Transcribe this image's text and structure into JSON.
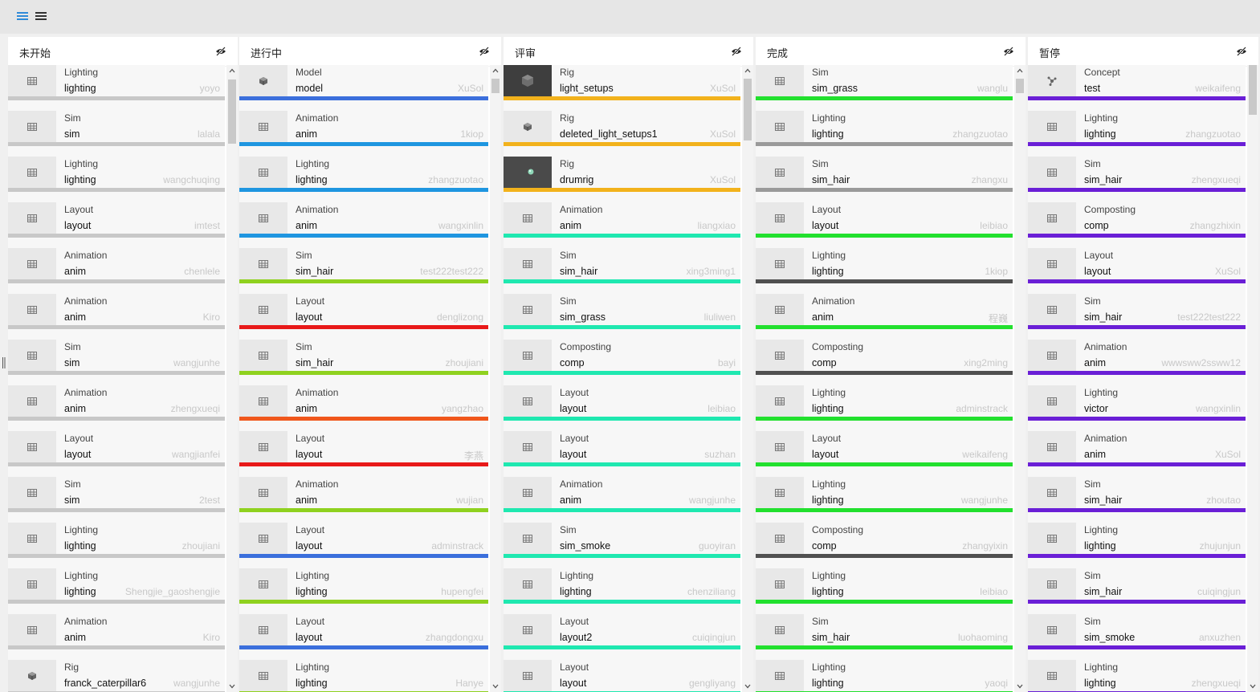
{
  "toolbar": {
    "buttons": [
      {
        "name": "list-view-icon",
        "color": "#2f8ad8"
      },
      {
        "name": "menu-icon",
        "color": "#333333"
      }
    ]
  },
  "columns": [
    {
      "title": "未开始",
      "hide_icon": "eye-slash-icon",
      "bar_color": "#c8c8c8",
      "cards": [
        {
          "step": "Lighting",
          "task": "lighting",
          "assignee": "yoyo",
          "icon": "table-icon"
        },
        {
          "step": "Sim",
          "task": "sim",
          "assignee": "lalala",
          "icon": "table-icon"
        },
        {
          "step": "Lighting",
          "task": "lighting",
          "assignee": "wangchuqing",
          "icon": "table-icon"
        },
        {
          "step": "Layout",
          "task": "layout",
          "assignee": "imtest",
          "icon": "table-icon"
        },
        {
          "step": "Animation",
          "task": "anim",
          "assignee": "chenlele",
          "icon": "table-icon"
        },
        {
          "step": "Animation",
          "task": "anim",
          "assignee": "Kiro",
          "icon": "table-icon"
        },
        {
          "step": "Sim",
          "task": "sim",
          "assignee": "wangjunhe",
          "icon": "table-icon"
        },
        {
          "step": "Animation",
          "task": "anim",
          "assignee": "zhengxueqi",
          "icon": "table-icon"
        },
        {
          "step": "Layout",
          "task": "layout",
          "assignee": "wangjianfei",
          "icon": "table-icon"
        },
        {
          "step": "Sim",
          "task": "sim",
          "assignee": "2test",
          "icon": "table-icon"
        },
        {
          "step": "Lighting",
          "task": "lighting",
          "assignee": "zhoujiani",
          "icon": "table-icon"
        },
        {
          "step": "Lighting",
          "task": "lighting",
          "assignee": "Shengjie_gaoshengjie",
          "icon": "table-icon"
        },
        {
          "step": "Animation",
          "task": "anim",
          "assignee": "Kiro",
          "icon": "table-icon"
        },
        {
          "step": "Rig",
          "task": "franck_caterpillar6",
          "assignee": "wangjunhe",
          "icon": "cube-icon"
        }
      ]
    },
    {
      "title": "进行中",
      "hide_icon": "eye-slash-icon",
      "cards": [
        {
          "step": "Model",
          "task": "model",
          "assignee": "XuSol",
          "icon": "cube-icon",
          "color": "#3b6fdc"
        },
        {
          "step": "Animation",
          "task": "anim",
          "assignee": "1kiop",
          "icon": "table-icon",
          "color": "#1f96e0"
        },
        {
          "step": "Lighting",
          "task": "lighting",
          "assignee": "zhangzuotao",
          "icon": "table-icon",
          "color": "#1f96e0"
        },
        {
          "step": "Animation",
          "task": "anim",
          "assignee": "wangxinlin",
          "icon": "table-icon",
          "color": "#1f96e0"
        },
        {
          "step": "Sim",
          "task": "sim_hair",
          "assignee": "test222test222",
          "icon": "table-icon",
          "color": "#8fd11f"
        },
        {
          "step": "Layout",
          "task": "layout",
          "assignee": "denglizong",
          "icon": "table-icon",
          "color": "#e81919"
        },
        {
          "step": "Sim",
          "task": "sim_hair",
          "assignee": "zhoujiani",
          "icon": "table-icon",
          "color": "#8fd11f"
        },
        {
          "step": "Animation",
          "task": "anim",
          "assignee": "yangzhao",
          "icon": "table-icon",
          "color": "#f0571c"
        },
        {
          "step": "Layout",
          "task": "layout",
          "assignee": "李燕",
          "icon": "table-icon",
          "color": "#e81919"
        },
        {
          "step": "Animation",
          "task": "anim",
          "assignee": "wujian",
          "icon": "table-icon",
          "color": "#8fd11f"
        },
        {
          "step": "Layout",
          "task": "layout",
          "assignee": "adminstrack",
          "icon": "table-icon",
          "color": "#3b6fdc"
        },
        {
          "step": "Lighting",
          "task": "lighting",
          "assignee": "hupengfei",
          "icon": "table-icon",
          "color": "#8fd11f"
        },
        {
          "step": "Layout",
          "task": "layout",
          "assignee": "zhangdongxu",
          "icon": "table-icon",
          "color": "#3b6fdc"
        },
        {
          "step": "Lighting",
          "task": "lighting",
          "assignee": "Hanye",
          "icon": "table-icon",
          "color": "#8fd11f"
        }
      ]
    },
    {
      "title": "评审",
      "hide_icon": "eye-slash-icon",
      "cards": [
        {
          "step": "Rig",
          "task": "light_setups",
          "assignee": "XuSol",
          "icon": "render-thumbnail",
          "color": "#f2b21c"
        },
        {
          "step": "Rig",
          "task": "deleted_light_setups1",
          "assignee": "XuSol",
          "icon": "cube-icon",
          "color": "#f2b21c"
        },
        {
          "step": "Rig",
          "task": "drumrig",
          "assignee": "XuSol",
          "icon": "sphere-thumbnail",
          "color": "#f2b21c"
        },
        {
          "step": "Animation",
          "task": "anim",
          "assignee": "liangxiao",
          "icon": "table-icon",
          "color": "#1fe8b0"
        },
        {
          "step": "Sim",
          "task": "sim_hair",
          "assignee": "xing3ming1",
          "icon": "table-icon",
          "color": "#1fe8b0"
        },
        {
          "step": "Sim",
          "task": "sim_grass",
          "assignee": "liuliwen",
          "icon": "table-icon",
          "color": "#1fe8b0"
        },
        {
          "step": "Composting",
          "task": "comp",
          "assignee": "bayi",
          "icon": "table-icon",
          "color": "#1fe8b0"
        },
        {
          "step": "Layout",
          "task": "layout",
          "assignee": "leibiao",
          "icon": "table-icon",
          "color": "#1fe8b0"
        },
        {
          "step": "Layout",
          "task": "layout",
          "assignee": "suzhan",
          "icon": "table-icon",
          "color": "#1fe8b0"
        },
        {
          "step": "Animation",
          "task": "anim",
          "assignee": "wangjunhe",
          "icon": "table-icon",
          "color": "#1fe8b0"
        },
        {
          "step": "Sim",
          "task": "sim_smoke",
          "assignee": "guoyiran",
          "icon": "table-icon",
          "color": "#1fe8b0"
        },
        {
          "step": "Lighting",
          "task": "lighting",
          "assignee": "chenziliang",
          "icon": "table-icon",
          "color": "#1fe8b0"
        },
        {
          "step": "Layout",
          "task": "layout2",
          "assignee": "cuiqingjun",
          "icon": "table-icon",
          "color": "#1fe8b0"
        },
        {
          "step": "Layout",
          "task": "layout",
          "assignee": "gengliyang",
          "icon": "table-icon",
          "color": "#1fe8b0"
        }
      ]
    },
    {
      "title": "完成",
      "hide_icon": "eye-slash-icon",
      "cards": [
        {
          "step": "Sim",
          "task": "sim_grass",
          "assignee": "wanglu",
          "icon": "table-icon",
          "color": "#22e02e"
        },
        {
          "step": "Lighting",
          "task": "lighting",
          "assignee": "zhangzuotao",
          "icon": "table-icon",
          "color": "#9a9a9a"
        },
        {
          "step": "Sim",
          "task": "sim_hair",
          "assignee": "zhangxu",
          "icon": "table-icon",
          "color": "#9a9a9a"
        },
        {
          "step": "Layout",
          "task": "layout",
          "assignee": "leibiao",
          "icon": "table-icon",
          "color": "#22e02e"
        },
        {
          "step": "Lighting",
          "task": "lighting",
          "assignee": "1kiop",
          "icon": "table-icon",
          "color": "#505050"
        },
        {
          "step": "Animation",
          "task": "anim",
          "assignee": "程巍",
          "icon": "table-icon",
          "color": "#22e02e"
        },
        {
          "step": "Composting",
          "task": "comp",
          "assignee": "xing2ming",
          "icon": "table-icon",
          "color": "#505050"
        },
        {
          "step": "Lighting",
          "task": "lighting",
          "assignee": "adminstrack",
          "icon": "table-icon",
          "color": "#22e02e"
        },
        {
          "step": "Layout",
          "task": "layout",
          "assignee": "weikaifeng",
          "icon": "table-icon",
          "color": "#22e02e"
        },
        {
          "step": "Lighting",
          "task": "lighting",
          "assignee": "wangjunhe",
          "icon": "table-icon",
          "color": "#22e02e"
        },
        {
          "step": "Composting",
          "task": "comp",
          "assignee": "zhangyixin",
          "icon": "table-icon",
          "color": "#505050"
        },
        {
          "step": "Lighting",
          "task": "lighting",
          "assignee": "leibiao",
          "icon": "table-icon",
          "color": "#22e02e"
        },
        {
          "step": "Sim",
          "task": "sim_hair",
          "assignee": "luohaoming",
          "icon": "table-icon",
          "color": "#22e02e"
        },
        {
          "step": "Lighting",
          "task": "lighting",
          "assignee": "yaoqi",
          "icon": "table-icon",
          "color": "#22e02e"
        }
      ]
    },
    {
      "title": "暂停",
      "hide_icon": "eye-slash-icon",
      "bar_color": "#6a1fd6",
      "cards": [
        {
          "step": "Concept",
          "task": "test",
          "assignee": "weikaifeng",
          "icon": "molecule-icon"
        },
        {
          "step": "Lighting",
          "task": "lighting",
          "assignee": "zhangzuotao",
          "icon": "table-icon"
        },
        {
          "step": "Sim",
          "task": "sim_hair",
          "assignee": "zhengxueqi",
          "icon": "table-icon"
        },
        {
          "step": "Composting",
          "task": "comp",
          "assignee": "zhangzhixin",
          "icon": "table-icon"
        },
        {
          "step": "Layout",
          "task": "layout",
          "assignee": "XuSol",
          "icon": "table-icon"
        },
        {
          "step": "Sim",
          "task": "sim_hair",
          "assignee": "test222test222",
          "icon": "table-icon"
        },
        {
          "step": "Animation",
          "task": "anim",
          "assignee": "wwwsww2ssww12",
          "icon": "table-icon"
        },
        {
          "step": "Lighting",
          "task": "victor",
          "assignee": "wangxinlin",
          "icon": "table-icon"
        },
        {
          "step": "Animation",
          "task": "anim",
          "assignee": "XuSol",
          "icon": "table-icon"
        },
        {
          "step": "Sim",
          "task": "sim_hair",
          "assignee": "zhoutao",
          "icon": "table-icon"
        },
        {
          "step": "Lighting",
          "task": "lighting",
          "assignee": "zhujunjun",
          "icon": "table-icon"
        },
        {
          "step": "Sim",
          "task": "sim_hair",
          "assignee": "cuiqingjun",
          "icon": "table-icon"
        },
        {
          "step": "Sim",
          "task": "sim_smoke",
          "assignee": "anxuzhen",
          "icon": "table-icon"
        },
        {
          "step": "Lighting",
          "task": "lighting",
          "assignee": "zhengxueqi",
          "icon": "table-icon"
        }
      ]
    }
  ]
}
